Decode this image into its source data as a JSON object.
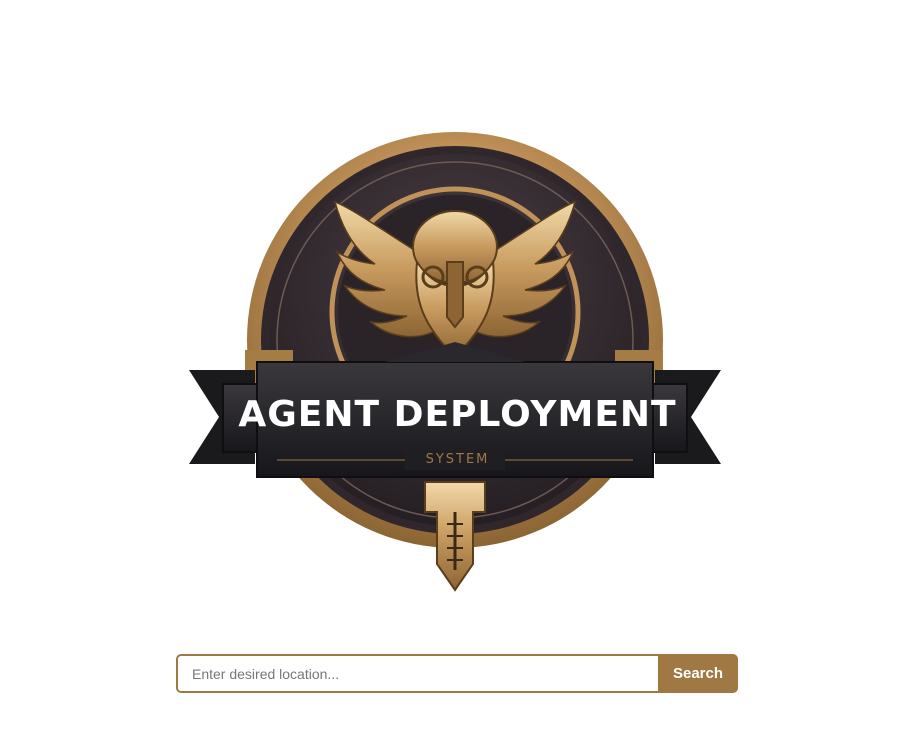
{
  "logo": {
    "title": "AGENT DEPLOYMENT",
    "subtitle": "SYSTEM",
    "icon": "winged-helmet-emblem-icon",
    "colors": {
      "gold": "#c09158",
      "dark": "#2b2528",
      "banner": "#1f1e22"
    }
  },
  "search": {
    "placeholder": "Enter desired location...",
    "value": "",
    "button_label": "Search",
    "accent": "#a07844"
  }
}
